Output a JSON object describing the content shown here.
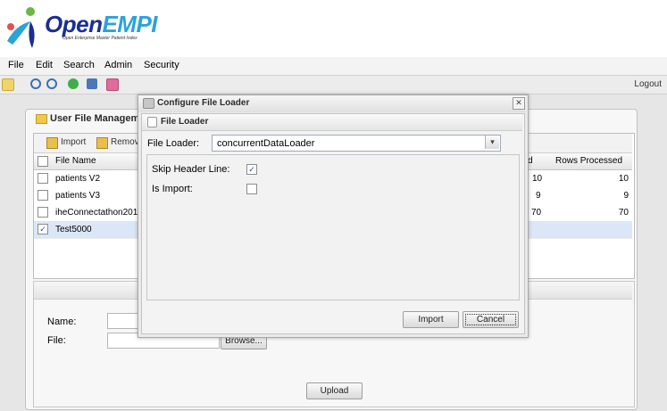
{
  "header": {
    "logo_main": "Open",
    "logo_accent": "EMPI",
    "tagline": "Open Enterprise Master Patient Index"
  },
  "menu": {
    "items": [
      {
        "label": "File"
      },
      {
        "label": "Edit"
      },
      {
        "label": "Search"
      },
      {
        "label": "Admin"
      },
      {
        "label": "Security"
      }
    ]
  },
  "toolbar": {
    "logout": "Logout"
  },
  "user_file_panel": {
    "title": "User File Managemen",
    "import_label": "Import",
    "remove_label": "Remov",
    "columns": {
      "file_name": "File Name",
      "col_partial": "d",
      "rows_processed": "Rows Processed"
    },
    "rows": [
      {
        "name": "patients V2",
        "col_partial": "10",
        "rows_processed": "10",
        "checked": ""
      },
      {
        "name": "patients V3",
        "col_partial": "9",
        "rows_processed": "9",
        "checked": ""
      },
      {
        "name": "iheConnectathon2013.c",
        "col_partial": "70",
        "rows_processed": "70",
        "checked": ""
      },
      {
        "name": "Test5000",
        "col_partial": "",
        "rows_processed": "",
        "checked": "✓"
      }
    ],
    "form": {
      "name_label": "Name:",
      "file_label": "File:",
      "browse_label": "Browse...",
      "upload_label": "Upload"
    }
  },
  "dialog": {
    "title": "Configure File Loader",
    "panel_title": "File Loader",
    "file_loader_label": "File Loader:",
    "file_loader_value": "concurrentDataLoader",
    "skip_header_label": "Skip Header Line:",
    "skip_header_checked": "✓",
    "is_import_label": "Is Import:",
    "is_import_checked": "",
    "import_button": "Import",
    "cancel_button": "Cancel",
    "close_glyph": "✕",
    "dropdown_glyph": "▾"
  }
}
